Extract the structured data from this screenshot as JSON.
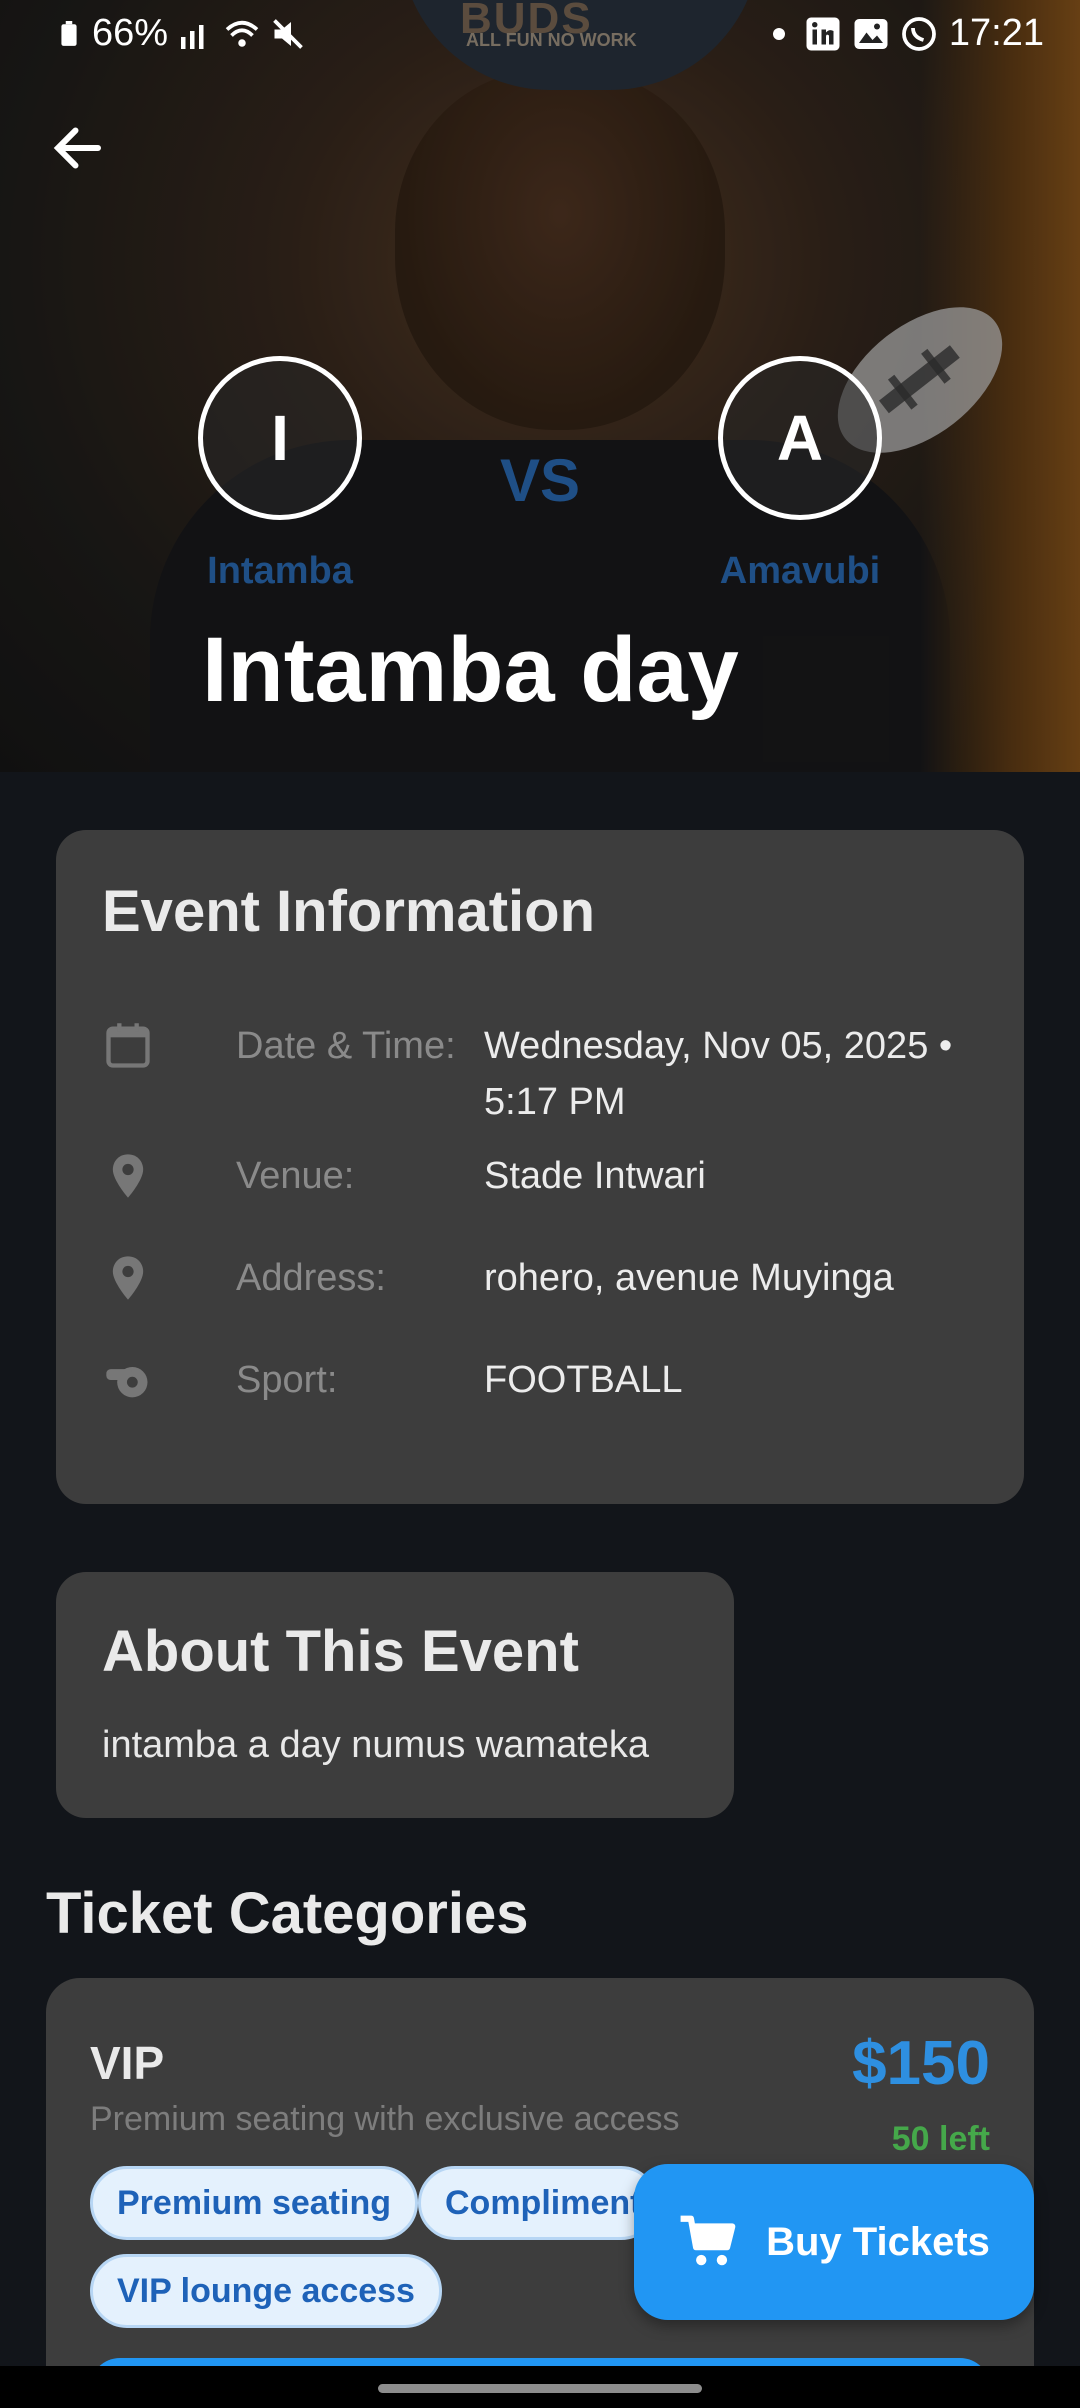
{
  "status_bar": {
    "battery": "66%",
    "time": "17:21",
    "icons": [
      "battery-icon",
      "signal-icon",
      "wifi-icon",
      "mute-icon",
      "linkedin-icon",
      "gallery-icon",
      "whatsapp-icon"
    ]
  },
  "hero": {
    "hat_text": "BUDS",
    "hat_sub": "ALL FUN NO WORK",
    "home_team": {
      "initial": "I",
      "name": "Intamba"
    },
    "vs_label": "VS",
    "away_team": {
      "initial": "A",
      "name": "Amavubi"
    },
    "title": "Intamba day",
    "background_icon": "football-icon"
  },
  "event_info": {
    "title": "Event Information",
    "rows": [
      {
        "icon": "calendar-icon",
        "label": "Date & Time:",
        "value": "Wednesday, Nov 05, 2025 • 5:17 PM"
      },
      {
        "icon": "location-pin-icon",
        "label": "Venue:",
        "value": "Stade Intwari"
      },
      {
        "icon": "location-pin-icon",
        "label": "Address:",
        "value": "rohero, avenue Muyinga"
      },
      {
        "icon": "whistle-icon",
        "label": "Sport:",
        "value": "FOOTBALL"
      }
    ]
  },
  "about": {
    "title": "About This Event",
    "text": "intamba a day numus wamateka"
  },
  "tickets": {
    "section_title": "Ticket Categories",
    "categories": [
      {
        "name": "VIP",
        "description": "Premium seating with exclusive access",
        "price": "$150",
        "remaining": "50 left",
        "perks": [
          "Premium seating",
          "Complimentary",
          "VIP lounge access"
        ]
      }
    ]
  },
  "fab": {
    "label": "Buy Tickets",
    "icon": "cart-icon"
  },
  "colors": {
    "accent": "#2196f3",
    "price": "#2e8fe0",
    "available": "#45a84a",
    "card": "#3d3d3d",
    "background": "#12151a",
    "team_name": "#1f4f86"
  }
}
